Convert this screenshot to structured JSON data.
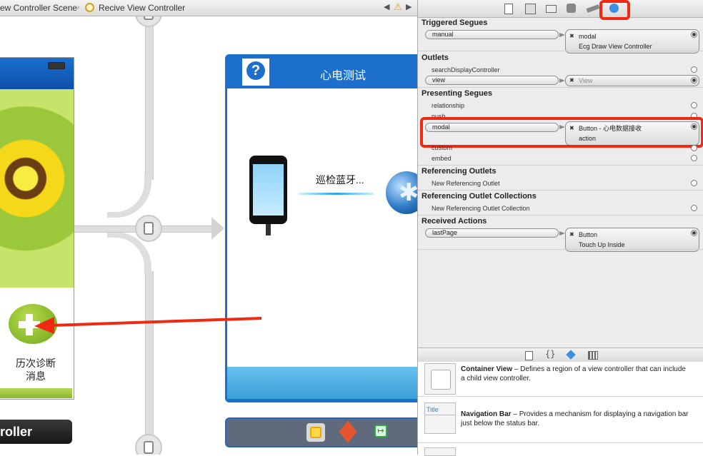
{
  "jumpbar": {
    "crumb_scene": "ew Controller Scene",
    "crumb_controller": "Recive View Controller"
  },
  "canvas": {
    "left_scene": {
      "history_label_line1": "历次诊断",
      "history_label_line2": "消息",
      "controller_label": "roller"
    },
    "center_scene": {
      "title": "心电测试",
      "scan_text": "巡检蓝牙..."
    }
  },
  "inspector": {
    "tabs": [
      "file-icon",
      "quick-help-icon",
      "identity-icon",
      "attributes-icon",
      "size-icon",
      "connections-icon"
    ],
    "sections": {
      "triggered_segues": {
        "title": "Triggered Segues",
        "manual_label": "manual",
        "dest_line1": "modal",
        "dest_line2": "Ecg Draw View Controller"
      },
      "outlets": {
        "title": "Outlets",
        "search_display": "searchDisplayController",
        "view_label": "view",
        "view_dest": "View"
      },
      "presenting_segues": {
        "title": "Presenting Segues",
        "relationship": "relationship",
        "push": "push",
        "modal_label": "modal",
        "modal_dest_line1": "Button - 心电数据接收",
        "modal_dest_line2": "action",
        "custom": "custom",
        "embed": "embed"
      },
      "referencing_outlets": {
        "title": "Referencing Outlets",
        "new_outlet": "New Referencing Outlet"
      },
      "referencing_outlet_collections": {
        "title": "Referencing Outlet Collections",
        "new_collection": "New Referencing Outlet Collection"
      },
      "received_actions": {
        "title": "Received Actions",
        "action_label": "lastPage",
        "dest_line1": "Button",
        "dest_line2": "Touch Up Inside"
      }
    }
  },
  "library": {
    "tabs": [
      "file-template-icon",
      "code-snippet-icon",
      "object-library-icon",
      "media-library-icon"
    ],
    "items": [
      {
        "name": "Container View",
        "desc": " – Defines a region of a view controller that can include a child view controller."
      },
      {
        "name": "Navigation Bar",
        "desc": " – Provides a mechanism for displaying a navigation bar just below the status bar.",
        "thumb_text": "Title"
      }
    ]
  },
  "colors": {
    "highlight_red": "#f02a12",
    "storyboard_blue": "#1d6fcd",
    "selected_tab_blue": "#3a8fe0"
  }
}
